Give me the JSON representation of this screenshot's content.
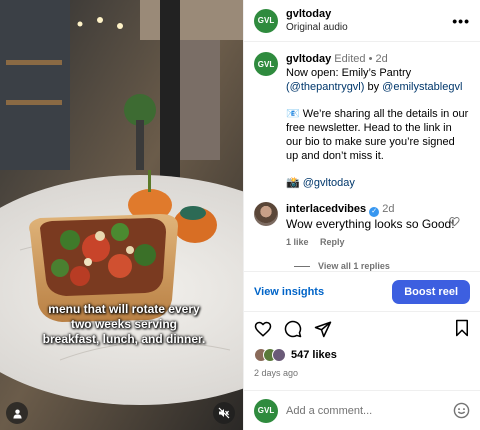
{
  "media": {
    "caption_lines": [
      "menu that will rotate every",
      "two weeks serving",
      "breakfast, lunch, and dinner."
    ]
  },
  "header": {
    "username": "gvltoday",
    "audio": "Original audio",
    "logo_text": "GVL"
  },
  "post": {
    "username": "gvltoday",
    "edited": "Edited",
    "time": "2d",
    "line1": "Now open: Emily’s Pantry",
    "mention1": "(@thepantrygvl)",
    "by": " by ",
    "mention2": "@emilystablegvl",
    "para2_emoji": "📧",
    "para2": " We’re sharing all the details in our free newsletter. Head to the link in our bio to make sure you’re signed up and don’t miss it.",
    "para3_emoji": "📸",
    "para3_link": "@gvltoday"
  },
  "comment": {
    "username": "interlacedvibes",
    "time": "2d",
    "text": "Wow everything looks so Good!",
    "likes": "1 like",
    "reply": "Reply",
    "view_replies": "View all 1 replies"
  },
  "insights": {
    "view": "View insights",
    "boost": "Boost reel"
  },
  "stats": {
    "likes": "547 likes",
    "age": "2 days ago"
  },
  "add_comment": {
    "placeholder": "Add a comment..."
  },
  "colors": {
    "brand_green": "#2f8b3e",
    "link_blue": "#0064c8",
    "boost_blue": "#3d5fe0"
  }
}
